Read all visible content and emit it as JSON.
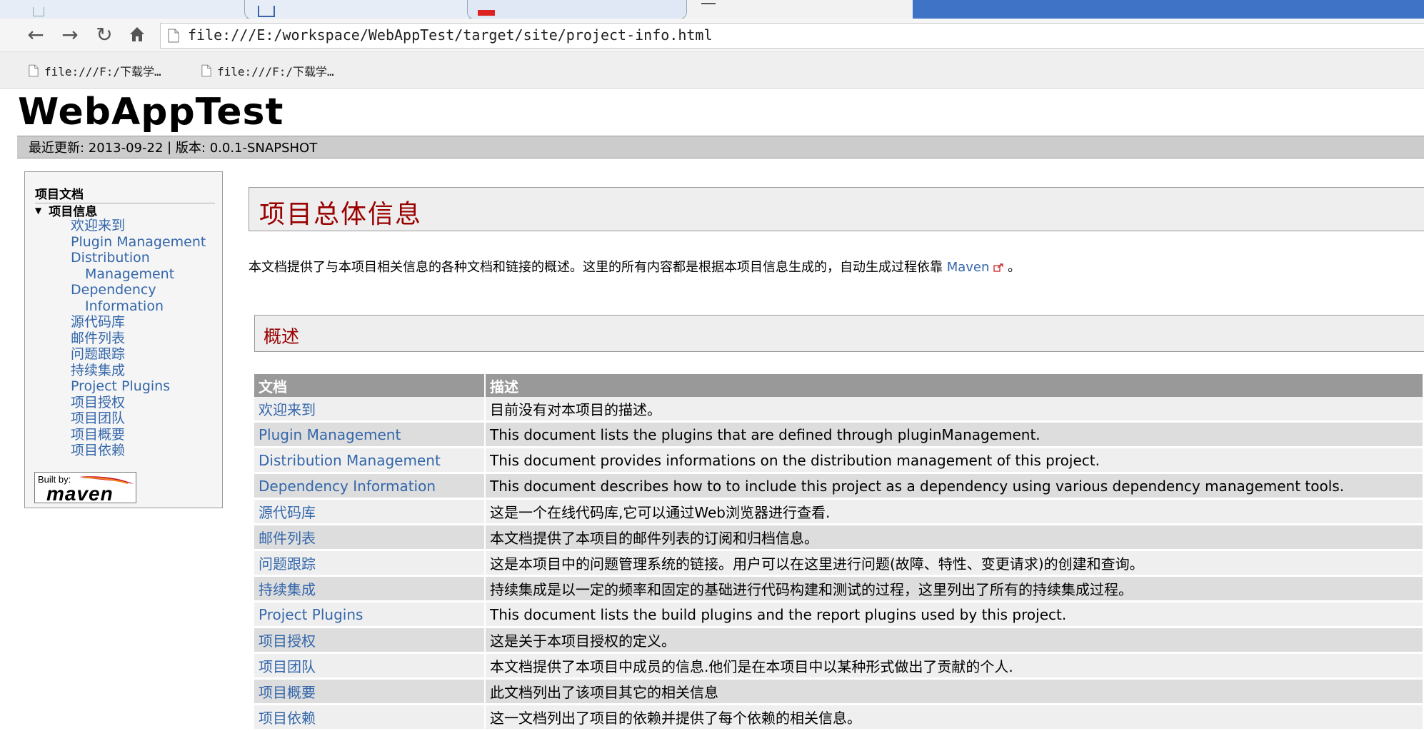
{
  "browser": {
    "address_url": "file:///E:/workspace/WebAppTest/target/site/project-info.html",
    "bookmarks": [
      {
        "label": "file:///F:/下载学…"
      },
      {
        "label": "file:///F:/下载学…"
      }
    ]
  },
  "site": {
    "title": "WebAppTest",
    "breadcrumb": {
      "updated_label": "最近更新: 2013-09-22",
      "separator": " | ",
      "version_label": "版本: 0.0.1-SNAPSHOT"
    }
  },
  "sidebar": {
    "heading": "项目文档",
    "section": "项目信息",
    "items": [
      {
        "label": "欢迎来到"
      },
      {
        "label": "Plugin Management"
      },
      {
        "label": "Distribution",
        "label2": "Management"
      },
      {
        "label": "Dependency",
        "label2": "Information"
      },
      {
        "label": "源代码库"
      },
      {
        "label": "邮件列表"
      },
      {
        "label": "问题跟踪"
      },
      {
        "label": "持续集成"
      },
      {
        "label": "Project Plugins"
      },
      {
        "label": "项目授权"
      },
      {
        "label": "项目团队"
      },
      {
        "label": "项目概要"
      },
      {
        "label": "项目依赖"
      }
    ],
    "built_by": {
      "label": "Built by:",
      "logo_text": "maven"
    }
  },
  "main": {
    "heading": "项目总体信息",
    "intro_text": "本文档提供了与本项目相关信息的各种文档和链接的概述。这里的所有内容都是根据本项目信息生成的，自动生成过程依靠 ",
    "intro_link": "Maven",
    "intro_end": " 。",
    "section_heading": "概述",
    "table": {
      "headers": {
        "doc": "文档",
        "desc": "描述"
      },
      "rows": [
        {
          "doc": "欢迎来到",
          "desc": "目前没有对本项目的描述。"
        },
        {
          "doc": "Plugin Management",
          "desc": "This document lists the plugins that are defined through pluginManagement."
        },
        {
          "doc": "Distribution Management",
          "desc": "This document provides informations on the distribution management of this project."
        },
        {
          "doc": "Dependency Information",
          "desc": "This document describes how to to include this project as a dependency using various dependency management tools."
        },
        {
          "doc": "源代码库",
          "desc": "这是一个在线代码库,它可以通过Web浏览器进行查看."
        },
        {
          "doc": "邮件列表",
          "desc": "本文档提供了本项目的邮件列表的订阅和归档信息。"
        },
        {
          "doc": "问题跟踪",
          "desc": "这是本项目中的问题管理系统的链接。用户可以在这里进行问题(故障、特性、变更请求)的创建和查询。"
        },
        {
          "doc": "持续集成",
          "desc": "持续集成是以一定的频率和固定的基础进行代码构建和测试的过程，这里列出了所有的持续集成过程。"
        },
        {
          "doc": "Project Plugins",
          "desc": "This document lists the build plugins and the report plugins used by this project."
        },
        {
          "doc": "项目授权",
          "desc": "这是关于本项目授权的定义。"
        },
        {
          "doc": "项目团队",
          "desc": "本文档提供了本项目中成员的信息.他们是在本项目中以某种形式做出了贡献的个人."
        },
        {
          "doc": "项目概要",
          "desc": "此文档列出了该项目其它的相关信息"
        },
        {
          "doc": "项目依赖",
          "desc": "这一文档列出了项目的依赖并提供了每个依赖的相关信息。"
        }
      ]
    }
  }
}
